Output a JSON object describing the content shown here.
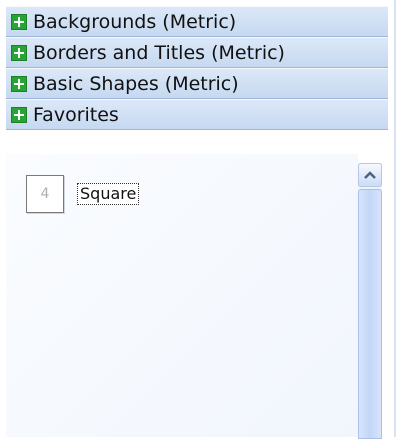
{
  "stencils": [
    {
      "label": "Backgrounds (Metric)"
    },
    {
      "label": "Borders and Titles (Metric)"
    },
    {
      "label": "Basic Shapes (Metric)"
    },
    {
      "label": "Favorites"
    }
  ],
  "favorites": {
    "items": [
      {
        "label": "Square",
        "icon_glyph": "4",
        "icon_name": "square-shape-icon"
      }
    ]
  },
  "colors": {
    "header_bg": "#c6d9f1",
    "expand_box": "#27a534",
    "content_bg": "#f1f6fd",
    "scrollbar_thumb": "#c2d6f6"
  }
}
